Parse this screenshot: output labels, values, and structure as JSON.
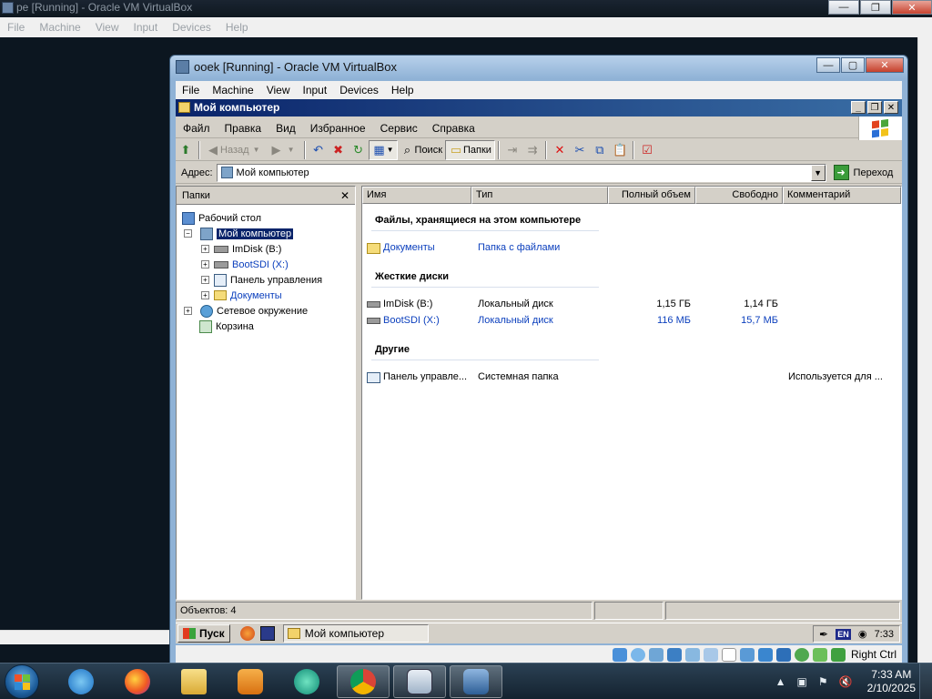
{
  "host": {
    "title": "pe [Running] - Oracle VM VirtualBox",
    "menu": [
      "File",
      "Machine",
      "View",
      "Input",
      "Devices",
      "Help"
    ]
  },
  "vbox": {
    "title": "ooek [Running] - Oracle VM VirtualBox",
    "menu": [
      "File",
      "Machine",
      "View",
      "Input",
      "Devices",
      "Help"
    ],
    "host_key": "Right Ctrl"
  },
  "explorer": {
    "title": "Мой компьютер",
    "menu": [
      "Файл",
      "Правка",
      "Вид",
      "Избранное",
      "Сервис",
      "Справка"
    ],
    "toolbar": {
      "back": "Назад",
      "search": "Поиск",
      "folders": "Папки"
    },
    "address": {
      "label": "Адрес:",
      "value": "Мой компьютер",
      "go": "Переход"
    },
    "folders_pane": {
      "title": "Папки",
      "items": [
        {
          "label": "Рабочий стол"
        },
        {
          "label": "Мой компьютер"
        },
        {
          "label": "ImDisk (B:)"
        },
        {
          "label": "BootSDI (X:)"
        },
        {
          "label": "Панель управления"
        },
        {
          "label": "Документы"
        },
        {
          "label": "Сетевое окружение"
        },
        {
          "label": "Корзина"
        }
      ]
    },
    "columns": [
      "Имя",
      "Тип",
      "Полный объем",
      "Свободно",
      "Комментарий"
    ],
    "groups": [
      {
        "title": "Файлы, хранящиеся на этом компьютере",
        "rows": [
          {
            "name": "Документы",
            "type": "Папка с файлами",
            "total": "",
            "free": "",
            "comment": ""
          }
        ]
      },
      {
        "title": "Жесткие диски",
        "rows": [
          {
            "name": "ImDisk (B:)",
            "type": "Локальный диск",
            "total": "1,15 ГБ",
            "free": "1,14 ГБ",
            "comment": ""
          },
          {
            "name": "BootSDI (X:)",
            "type": "Локальный диск",
            "total": "116 МБ",
            "free": "15,7 МБ",
            "comment": ""
          }
        ]
      },
      {
        "title": "Другие",
        "rows": [
          {
            "name": "Панель управле...",
            "type": "Системная папка",
            "total": "",
            "free": "",
            "comment": "Используется для ..."
          }
        ]
      }
    ],
    "status": "Объектов: 4"
  },
  "guest_taskbar": {
    "start": "Пуск",
    "task": "Мой компьютер",
    "lang": "EN",
    "time": "7:33"
  },
  "host_taskbar": {
    "time": "7:33 AM",
    "date": "2/10/2025"
  },
  "colors": {
    "selection": "#0a246a",
    "link": "#0b3fbd",
    "title_gradient_start": "#0a246a",
    "title_gradient_end": "#3a6ea5"
  }
}
